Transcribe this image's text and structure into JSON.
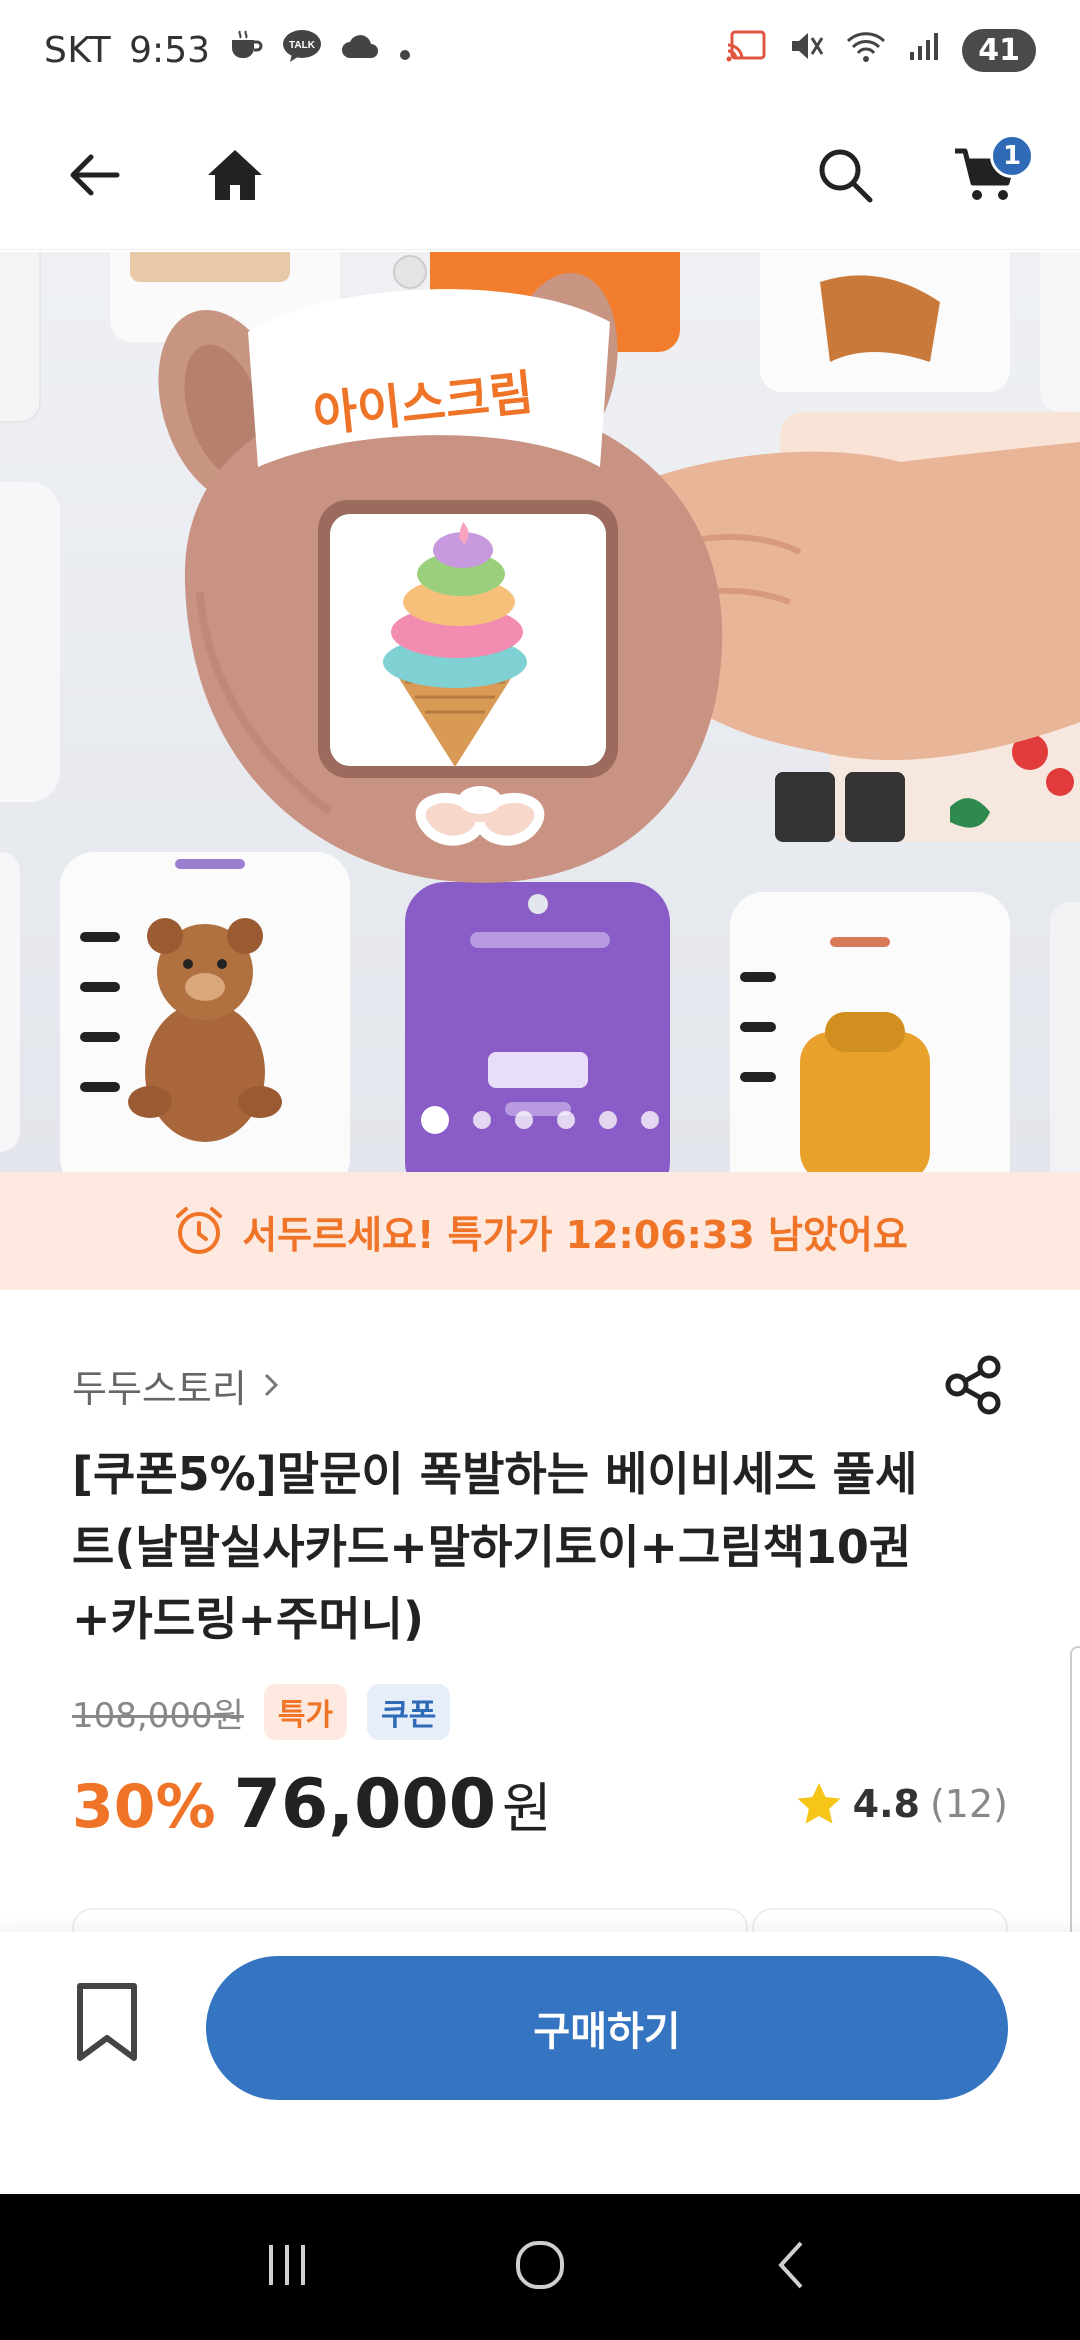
{
  "status_bar": {
    "carrier": "SKT",
    "time": "9:53",
    "notif_talk": "TALK",
    "battery": "41"
  },
  "nav": {
    "cart_count": "1"
  },
  "hero": {
    "slide_count": 6,
    "active_slide": 1
  },
  "sale": {
    "timer_text": "서두르세요! 특가가 12:06:33 남았어요"
  },
  "product": {
    "brand": "두두스토리",
    "title": "[쿠폰5%]말문이 폭발하는 베이비세즈 풀세트(날말실사카드+말하기토이+그림책10권+카드링+주머니)",
    "original_price": "108,000원",
    "tags": {
      "sale": "특가",
      "coupon": "쿠폰"
    },
    "discount": "30%",
    "price": "76,000",
    "currency": "원",
    "rating": "4.8",
    "review_count": "(12)"
  },
  "actions": {
    "buy_label": "구매하기"
  },
  "colors": {
    "accent_orange": "#f07427",
    "brand_blue": "#3474c1",
    "banner_bg": "#fde9df",
    "star": "#f5c518"
  }
}
